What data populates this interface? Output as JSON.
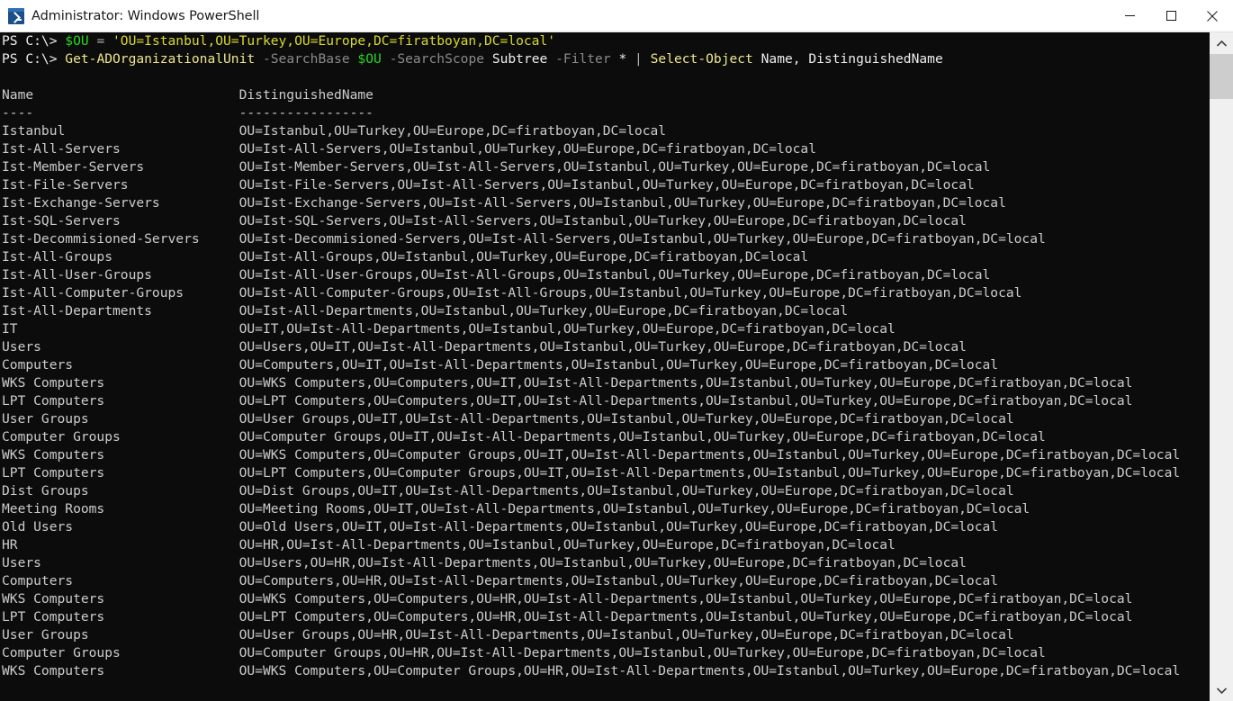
{
  "window": {
    "title": "Administrator: Windows PowerShell",
    "icon": "powershell-icon",
    "controls": {
      "minimize": "minimize-icon",
      "maximize": "maximize-icon",
      "close": "close-icon"
    },
    "background_color": "#0c0c0c",
    "titlebar_color": "#ffffff"
  },
  "scrollbar": {
    "up_arrow": "chevron-up-icon",
    "down_arrow": "chevron-down-icon",
    "thumb_position_percent": 0,
    "thumb_size_percent": 7
  },
  "terminal": {
    "prompt": "PS C:\\> ",
    "command_lines": [
      {
        "prompt": "PS C:\\> ",
        "tokens": [
          {
            "text": "$OU",
            "type": "variable"
          },
          {
            "text": " = ",
            "type": "operator"
          },
          {
            "text": "'OU=Istanbul,OU=Turkey,OU=Europe,DC=firatboyan,DC=local'",
            "type": "string"
          }
        ]
      },
      {
        "prompt": "PS C:\\> ",
        "tokens": [
          {
            "text": "Get-ADOrganizationalUnit",
            "type": "cmdlet"
          },
          {
            "text": " ",
            "type": "plain"
          },
          {
            "text": "-SearchBase",
            "type": "parameter"
          },
          {
            "text": " ",
            "type": "plain"
          },
          {
            "text": "$OU",
            "type": "variable"
          },
          {
            "text": " ",
            "type": "plain"
          },
          {
            "text": "-SearchScope",
            "type": "parameter"
          },
          {
            "text": " ",
            "type": "plain"
          },
          {
            "text": "Subtree",
            "type": "plain"
          },
          {
            "text": " ",
            "type": "plain"
          },
          {
            "text": "-Filter",
            "type": "parameter"
          },
          {
            "text": " ",
            "type": "plain"
          },
          {
            "text": "*",
            "type": "plain"
          },
          {
            "text": " ",
            "type": "plain"
          },
          {
            "text": "|",
            "type": "operator"
          },
          {
            "text": " ",
            "type": "plain"
          },
          {
            "text": "Select-Object",
            "type": "cmdlet"
          },
          {
            "text": " Name, DistinguishedName",
            "type": "plain"
          }
        ]
      }
    ],
    "table": {
      "headers": [
        "Name",
        "DistinguishedName"
      ],
      "separators": [
        "----",
        "-----------------"
      ],
      "rows": [
        [
          "Istanbul",
          "OU=Istanbul,OU=Turkey,OU=Europe,DC=firatboyan,DC=local"
        ],
        [
          "Ist-All-Servers",
          "OU=Ist-All-Servers,OU=Istanbul,OU=Turkey,OU=Europe,DC=firatboyan,DC=local"
        ],
        [
          "Ist-Member-Servers",
          "OU=Ist-Member-Servers,OU=Ist-All-Servers,OU=Istanbul,OU=Turkey,OU=Europe,DC=firatboyan,DC=local"
        ],
        [
          "Ist-File-Servers",
          "OU=Ist-File-Servers,OU=Ist-All-Servers,OU=Istanbul,OU=Turkey,OU=Europe,DC=firatboyan,DC=local"
        ],
        [
          "Ist-Exchange-Servers",
          "OU=Ist-Exchange-Servers,OU=Ist-All-Servers,OU=Istanbul,OU=Turkey,OU=Europe,DC=firatboyan,DC=local"
        ],
        [
          "Ist-SQL-Servers",
          "OU=Ist-SQL-Servers,OU=Ist-All-Servers,OU=Istanbul,OU=Turkey,OU=Europe,DC=firatboyan,DC=local"
        ],
        [
          "Ist-Decommisioned-Servers",
          "OU=Ist-Decommisioned-Servers,OU=Ist-All-Servers,OU=Istanbul,OU=Turkey,OU=Europe,DC=firatboyan,DC=local"
        ],
        [
          "Ist-All-Groups",
          "OU=Ist-All-Groups,OU=Istanbul,OU=Turkey,OU=Europe,DC=firatboyan,DC=local"
        ],
        [
          "Ist-All-User-Groups",
          "OU=Ist-All-User-Groups,OU=Ist-All-Groups,OU=Istanbul,OU=Turkey,OU=Europe,DC=firatboyan,DC=local"
        ],
        [
          "Ist-All-Computer-Groups",
          "OU=Ist-All-Computer-Groups,OU=Ist-All-Groups,OU=Istanbul,OU=Turkey,OU=Europe,DC=firatboyan,DC=local"
        ],
        [
          "Ist-All-Departments",
          "OU=Ist-All-Departments,OU=Istanbul,OU=Turkey,OU=Europe,DC=firatboyan,DC=local"
        ],
        [
          "IT",
          "OU=IT,OU=Ist-All-Departments,OU=Istanbul,OU=Turkey,OU=Europe,DC=firatboyan,DC=local"
        ],
        [
          "Users",
          "OU=Users,OU=IT,OU=Ist-All-Departments,OU=Istanbul,OU=Turkey,OU=Europe,DC=firatboyan,DC=local"
        ],
        [
          "Computers",
          "OU=Computers,OU=IT,OU=Ist-All-Departments,OU=Istanbul,OU=Turkey,OU=Europe,DC=firatboyan,DC=local"
        ],
        [
          "WKS Computers",
          "OU=WKS Computers,OU=Computers,OU=IT,OU=Ist-All-Departments,OU=Istanbul,OU=Turkey,OU=Europe,DC=firatboyan,DC=local"
        ],
        [
          "LPT Computers",
          "OU=LPT Computers,OU=Computers,OU=IT,OU=Ist-All-Departments,OU=Istanbul,OU=Turkey,OU=Europe,DC=firatboyan,DC=local"
        ],
        [
          "User Groups",
          "OU=User Groups,OU=IT,OU=Ist-All-Departments,OU=Istanbul,OU=Turkey,OU=Europe,DC=firatboyan,DC=local"
        ],
        [
          "Computer Groups",
          "OU=Computer Groups,OU=IT,OU=Ist-All-Departments,OU=Istanbul,OU=Turkey,OU=Europe,DC=firatboyan,DC=local"
        ],
        [
          "WKS Computers",
          "OU=WKS Computers,OU=Computer Groups,OU=IT,OU=Ist-All-Departments,OU=Istanbul,OU=Turkey,OU=Europe,DC=firatboyan,DC=local"
        ],
        [
          "LPT Computers",
          "OU=LPT Computers,OU=Computer Groups,OU=IT,OU=Ist-All-Departments,OU=Istanbul,OU=Turkey,OU=Europe,DC=firatboyan,DC=local"
        ],
        [
          "Dist Groups",
          "OU=Dist Groups,OU=IT,OU=Ist-All-Departments,OU=Istanbul,OU=Turkey,OU=Europe,DC=firatboyan,DC=local"
        ],
        [
          "Meeting Rooms",
          "OU=Meeting Rooms,OU=IT,OU=Ist-All-Departments,OU=Istanbul,OU=Turkey,OU=Europe,DC=firatboyan,DC=local"
        ],
        [
          "Old Users",
          "OU=Old Users,OU=IT,OU=Ist-All-Departments,OU=Istanbul,OU=Turkey,OU=Europe,DC=firatboyan,DC=local"
        ],
        [
          "HR",
          "OU=HR,OU=Ist-All-Departments,OU=Istanbul,OU=Turkey,OU=Europe,DC=firatboyan,DC=local"
        ],
        [
          "Users",
          "OU=Users,OU=HR,OU=Ist-All-Departments,OU=Istanbul,OU=Turkey,OU=Europe,DC=firatboyan,DC=local"
        ],
        [
          "Computers",
          "OU=Computers,OU=HR,OU=Ist-All-Departments,OU=Istanbul,OU=Turkey,OU=Europe,DC=firatboyan,DC=local"
        ],
        [
          "WKS Computers",
          "OU=WKS Computers,OU=Computers,OU=HR,OU=Ist-All-Departments,OU=Istanbul,OU=Turkey,OU=Europe,DC=firatboyan,DC=local"
        ],
        [
          "LPT Computers",
          "OU=LPT Computers,OU=Computers,OU=HR,OU=Ist-All-Departments,OU=Istanbul,OU=Turkey,OU=Europe,DC=firatboyan,DC=local"
        ],
        [
          "User Groups",
          "OU=User Groups,OU=HR,OU=Ist-All-Departments,OU=Istanbul,OU=Turkey,OU=Europe,DC=firatboyan,DC=local"
        ],
        [
          "Computer Groups",
          "OU=Computer Groups,OU=HR,OU=Ist-All-Departments,OU=Istanbul,OU=Turkey,OU=Europe,DC=firatboyan,DC=local"
        ],
        [
          "WKS Computers",
          "OU=WKS Computers,OU=Computer Groups,OU=HR,OU=Ist-All-Departments,OU=Istanbul,OU=Turkey,OU=Europe,DC=firatboyan,DC=local"
        ]
      ]
    }
  },
  "colors": {
    "variable": "#25d825",
    "string": "#d8d82f",
    "cmdlet": "#f0e68c",
    "parameter": "#8a8a8a",
    "output": "#cccccc",
    "background": "#0c0c0c"
  }
}
